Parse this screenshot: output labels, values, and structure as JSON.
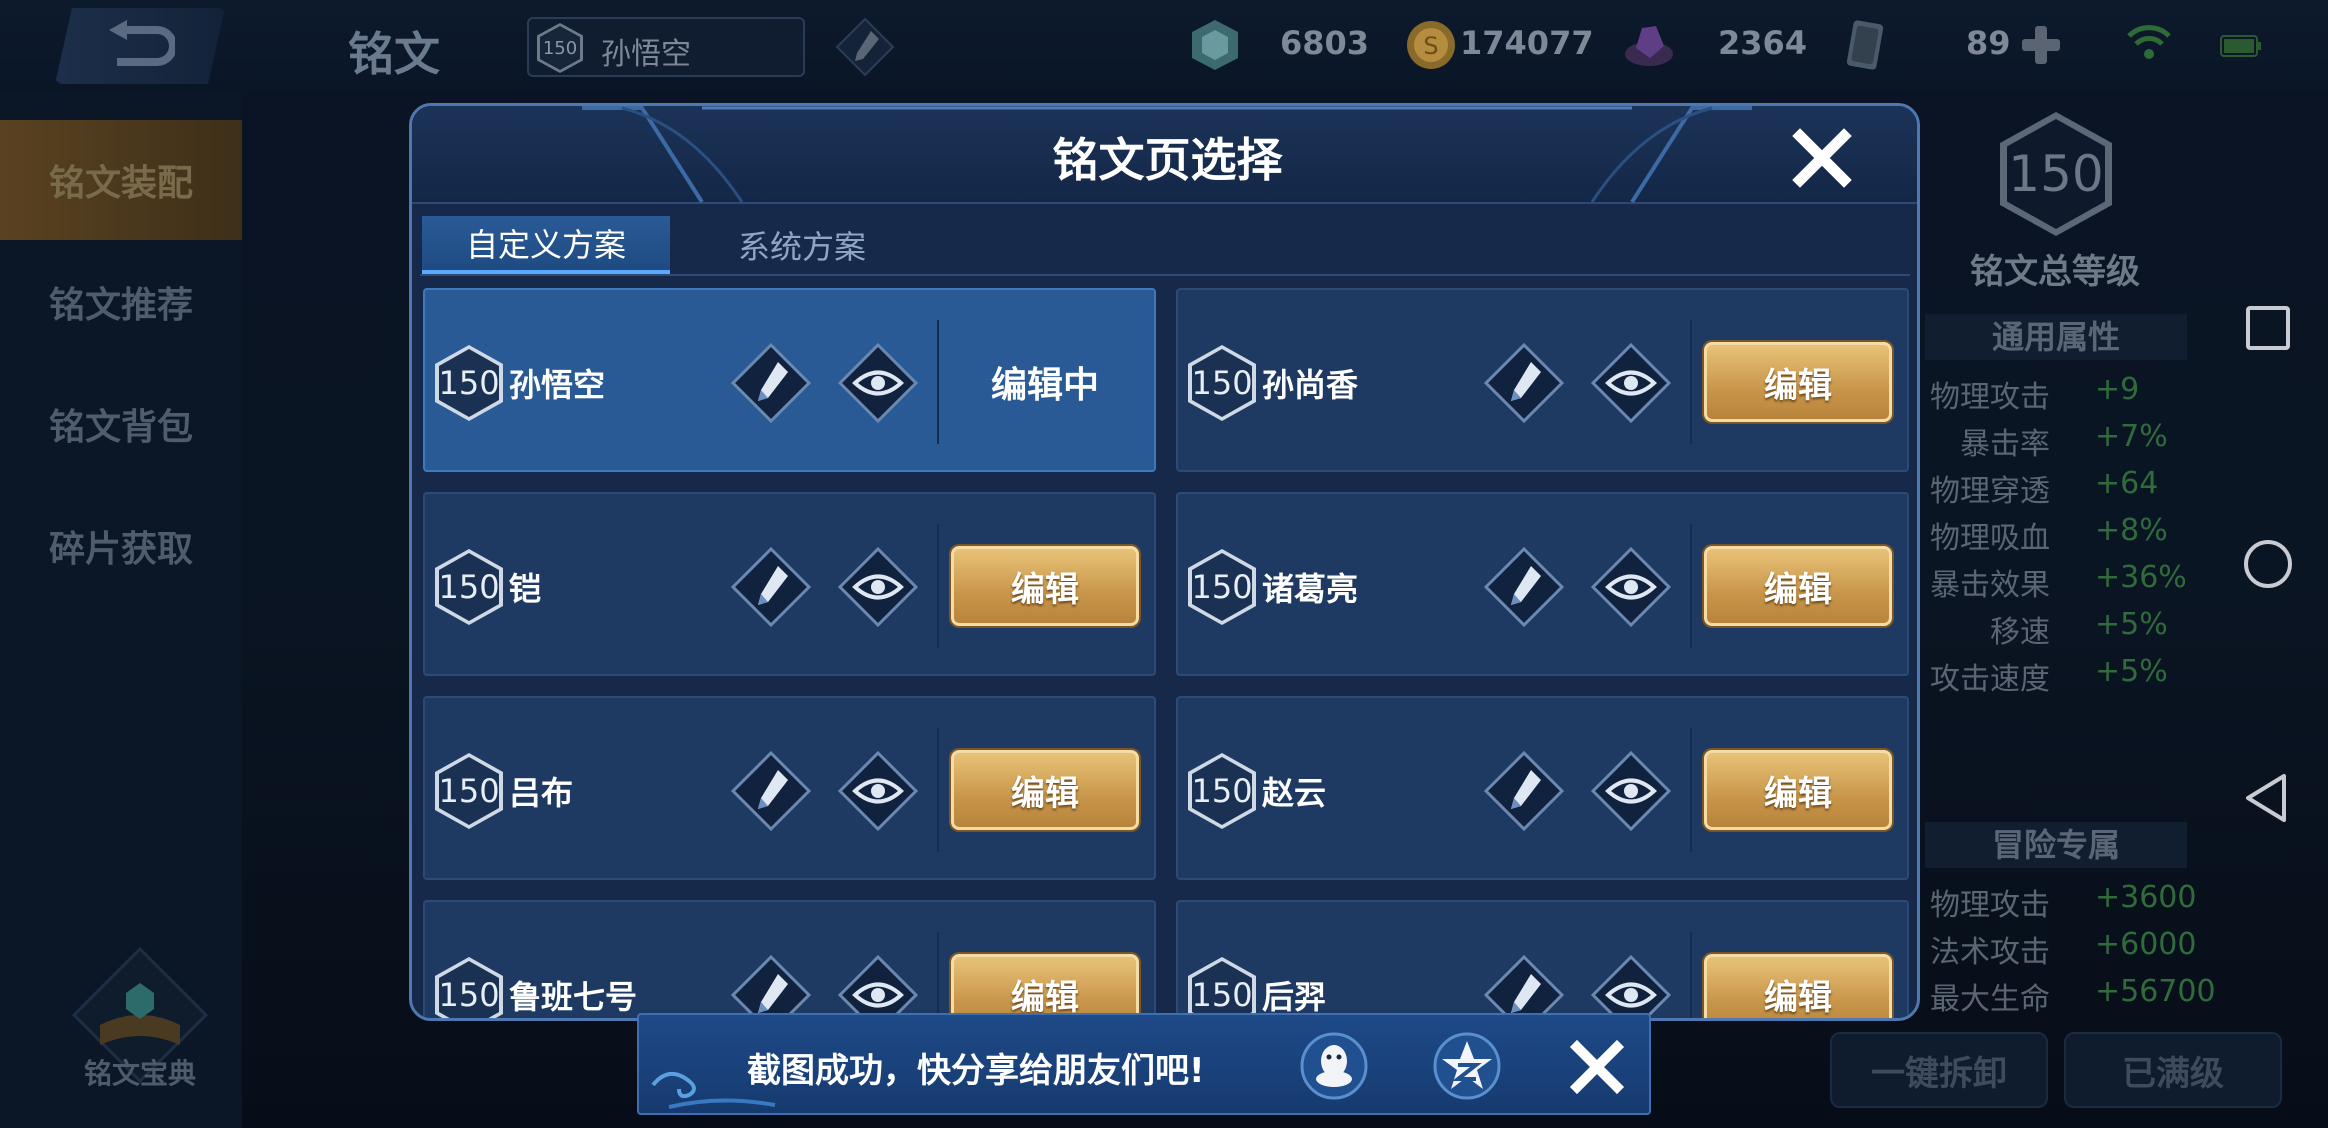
{
  "topbar": {
    "page_title": "铭文",
    "hero": {
      "level": "150",
      "name": "孙悟空"
    },
    "resources": [
      {
        "icon": "shield-gem-icon",
        "value": "6803"
      },
      {
        "icon": "gold-coin-icon",
        "value": "174077"
      },
      {
        "icon": "purple-crystal-icon",
        "value": "2364"
      },
      {
        "icon": "card-ticket-icon",
        "value": "89"
      }
    ]
  },
  "sidebar": {
    "items": [
      {
        "label": "铭文装配"
      },
      {
        "label": "铭文推荐"
      },
      {
        "label": "铭文背包"
      },
      {
        "label": "碎片获取"
      }
    ],
    "book_label": "铭文宝典"
  },
  "right_panel": {
    "level": "150",
    "level_label": "铭文总等级",
    "general_title": "通用属性",
    "general": [
      {
        "k": "物理攻击",
        "v": "+9"
      },
      {
        "k": "暴击率",
        "v": "+7%"
      },
      {
        "k": "物理穿透",
        "v": "+64"
      },
      {
        "k": "物理吸血",
        "v": "+8%"
      },
      {
        "k": "暴击效果",
        "v": "+36%"
      },
      {
        "k": "移速",
        "v": "+5%"
      },
      {
        "k": "攻击速度",
        "v": "+5%"
      }
    ],
    "adventure_title": "冒险专属",
    "adventure": [
      {
        "k": "物理攻击",
        "v": "+3600"
      },
      {
        "k": "法术攻击",
        "v": "+6000"
      },
      {
        "k": "最大生命",
        "v": "+56700"
      }
    ],
    "btn_dismantle": "一键拆卸",
    "btn_maxed": "已满级"
  },
  "dialog": {
    "title": "铭文页选择",
    "tabs": [
      {
        "label": "自定义方案"
      },
      {
        "label": "系统方案"
      }
    ],
    "cards": [
      {
        "level": "150",
        "name": "孙悟空",
        "action": "编辑中"
      },
      {
        "level": "150",
        "name": "孙尚香",
        "action": "编辑"
      },
      {
        "level": "150",
        "name": "铠",
        "action": "编辑"
      },
      {
        "level": "150",
        "name": "诸葛亮",
        "action": "编辑"
      },
      {
        "level": "150",
        "name": "吕布",
        "action": "编辑"
      },
      {
        "level": "150",
        "name": "赵云",
        "action": "编辑"
      },
      {
        "level": "150",
        "name": "鲁班七号",
        "action": "编辑"
      },
      {
        "level": "150",
        "name": "后羿",
        "action": "编辑"
      }
    ]
  },
  "toast": {
    "text": "截图成功，快分享给朋友们吧!"
  },
  "colors": {
    "accent_gold": "#c8964a",
    "dialog_bg": "#17294a",
    "active_card": "#2a5a96"
  }
}
